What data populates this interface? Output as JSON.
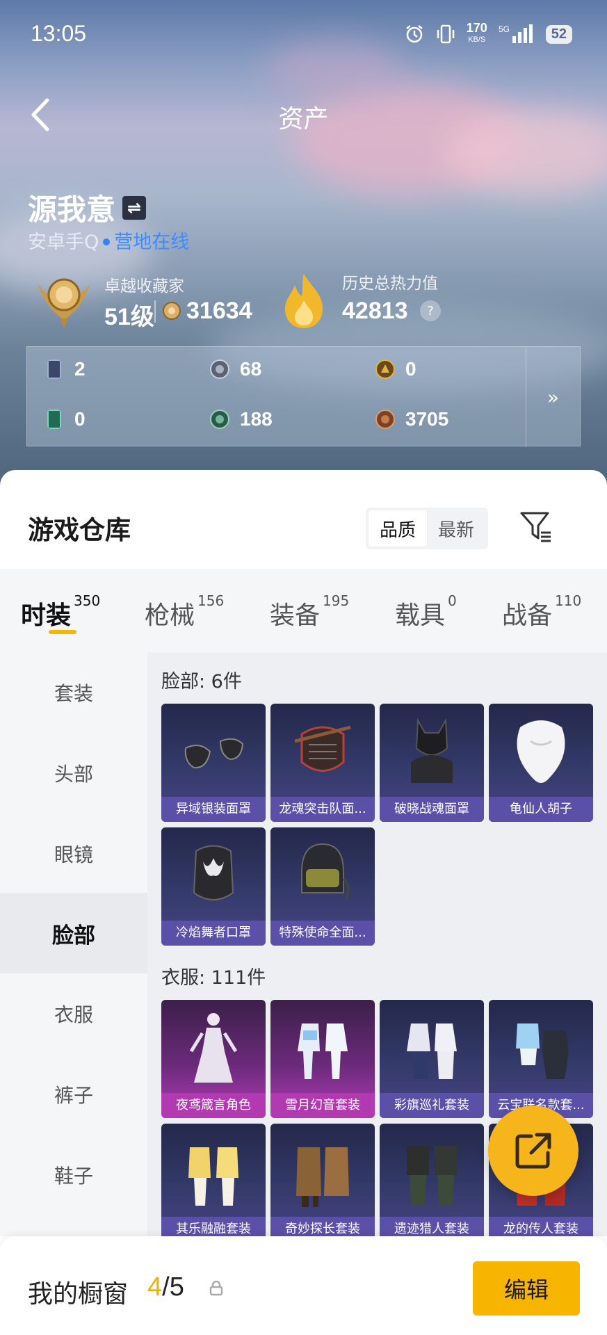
{
  "status_bar": {
    "time": "13:05",
    "net_speed": "170",
    "net_unit": "KB/S",
    "network": "5G",
    "battery": "52"
  },
  "header": {
    "title": "资产"
  },
  "profile": {
    "name": "源我意",
    "platform": "安卓手Q",
    "online_status": "营地在线"
  },
  "achievement": {
    "label": "卓越收藏家",
    "level": "51级",
    "points": "31634"
  },
  "heat": {
    "label": "历史总热力值",
    "value": "42813",
    "help": "?"
  },
  "currencies": [
    {
      "icon": "card-icon",
      "value": "2"
    },
    {
      "icon": "silver-coin-icon",
      "value": "68"
    },
    {
      "icon": "gold-coin-icon",
      "value": "0"
    },
    {
      "icon": "green-card-icon",
      "value": "0"
    },
    {
      "icon": "green-coin-icon",
      "value": "188"
    },
    {
      "icon": "bronze-coin-icon",
      "value": "3705"
    }
  ],
  "more_label": "»",
  "warehouse": {
    "title": "游戏仓库",
    "sort": [
      "品质",
      "最新"
    ],
    "tabs": [
      {
        "label": "时装",
        "count": "350"
      },
      {
        "label": "枪械",
        "count": "156"
      },
      {
        "label": "装备",
        "count": "195"
      },
      {
        "label": "载具",
        "count": "0"
      },
      {
        "label": "战备",
        "count": "110"
      }
    ],
    "categories": [
      "套装",
      "头部",
      "眼镜",
      "脸部",
      "衣服",
      "裤子",
      "鞋子"
    ],
    "sections": [
      {
        "title": "脸部: 6件",
        "items": [
          "异域银装面罩",
          "龙魂突击队面...",
          "破晓战魂面罩",
          "龟仙人胡子",
          "冷焰舞者口罩",
          "特殊使命全面..."
        ]
      },
      {
        "title": "衣服: 111件",
        "items": [
          "夜鸢箴言角色",
          "雪月幻音套装",
          "彩旗巡礼套装",
          "云宝联名款套...",
          "其乐融融套装",
          "奇妙探长套装",
          "遗迹猎人套装",
          "龙的传人套装"
        ]
      }
    ]
  },
  "showcase": {
    "label": "我的橱窗",
    "count": "4",
    "total": "/5",
    "edit": "编辑"
  },
  "colors": {
    "accent": "#f7b500",
    "online": "#3c8bff",
    "card": "#4a4486",
    "card_pink": "#b13bb5"
  }
}
